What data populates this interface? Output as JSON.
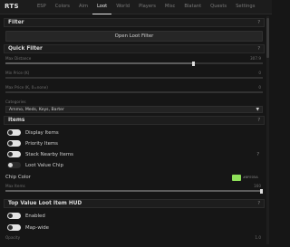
{
  "app": {
    "brand": "RTS"
  },
  "tabs": [
    "ESP",
    "Colors",
    "Aim",
    "Loot",
    "World",
    "Players",
    "Misc",
    "Blatant",
    "Quests",
    "Settings"
  ],
  "active_tab": 3,
  "sections": {
    "filter": {
      "title": "Filter",
      "help": "?",
      "button": "Open Loot Filter"
    },
    "quick_filter": {
      "title": "Quick Filter",
      "help": "?",
      "max_distance": {
        "label": "Max Distance",
        "value": "307.9",
        "fraction": 0.73
      },
      "min_price": {
        "label": "Min Price (K)",
        "value": "0",
        "fraction": 0.0
      },
      "max_price": {
        "label": "Max Price (K, 0=none)",
        "value": "0",
        "fraction": 0.0
      },
      "categories": {
        "label": "Categories",
        "value": "Ammo, Meds, Keys, Barter",
        "arrow": "▼"
      }
    },
    "items": {
      "title": "Items",
      "help": "?",
      "toggles": [
        {
          "label": "Display Items",
          "on": true
        },
        {
          "label": "Priority Items",
          "on": true
        },
        {
          "label": "Stack Nearby Items",
          "on": true,
          "help": "?"
        },
        {
          "label": "Loot Value Chip",
          "on": false
        }
      ],
      "chip_color": {
        "label": "Chip Color",
        "hex": "#8fe05a",
        "hex_label": "#8FE05A"
      },
      "max_items": {
        "label": "Max Items",
        "value": "160",
        "fraction": 1.0
      }
    },
    "top_value": {
      "title": "Top Value Loot Item HUD",
      "help": "?",
      "toggles": [
        {
          "label": "Enabled",
          "on": true
        },
        {
          "label": "Map-wide",
          "on": true
        }
      ],
      "opacity": {
        "label": "Opacity",
        "value": "1.0"
      }
    }
  }
}
